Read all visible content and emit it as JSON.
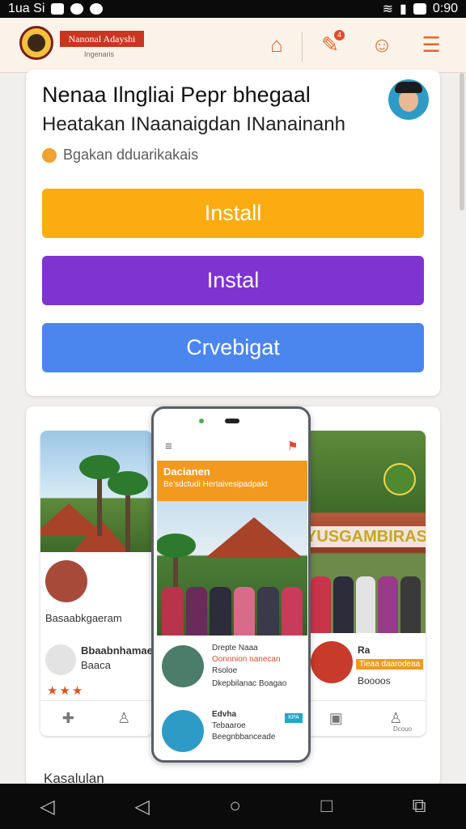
{
  "status_bar": {
    "left_text": "1ua Si",
    "time": "0:90"
  },
  "header": {
    "brand_name": "Nanonal Adayshi",
    "brand_subtitle": "Ingenaris",
    "notification_count": "4",
    "icons": [
      "home-icon",
      "edit-icon",
      "smile-icon",
      "menu-icon"
    ]
  },
  "app_card": {
    "title": "Nenaa Ilngliai Pepr bhegaal",
    "subtitle": "Heatakan INaanaigdan INanainanh",
    "meta": "Bgakan dduarikakais",
    "buttons": [
      {
        "label": "Install",
        "color": "#fcac10"
      },
      {
        "label": "Instal",
        "color": "#7f33d1"
      },
      {
        "label": "Crvebigat",
        "color": "#4b86ee"
      }
    ]
  },
  "screenshots": {
    "left": {
      "caption": "Basaabkgaeram",
      "item_title": "Bbaabnhamaegam",
      "item_sub": "Baaca",
      "stars": "★★★"
    },
    "center": {
      "banner_title": "Dacianen",
      "banner_sub": "Be'sdctudi Hertaivesipadpakt",
      "item1_line1": "Drepte Naaa",
      "item1_line2": "Oonnnion nanecan",
      "item1_line3": "Rsoloe",
      "item1_line4": "Dkepbilanac Boagao",
      "item2_line1": "Edvha",
      "item2_line2": "Tebaaroe",
      "item2_line3": "Beegnbbanceade",
      "tag": "KPA"
    },
    "right": {
      "sign": "YUSGAMBIRASE",
      "title": "Ra",
      "chip": "Tieaa daarodeaa",
      "sub": "Boooos",
      "tab_label": "Dcouo"
    }
  },
  "section_heading": "Kasalulan",
  "accent_color": "#e2672b"
}
